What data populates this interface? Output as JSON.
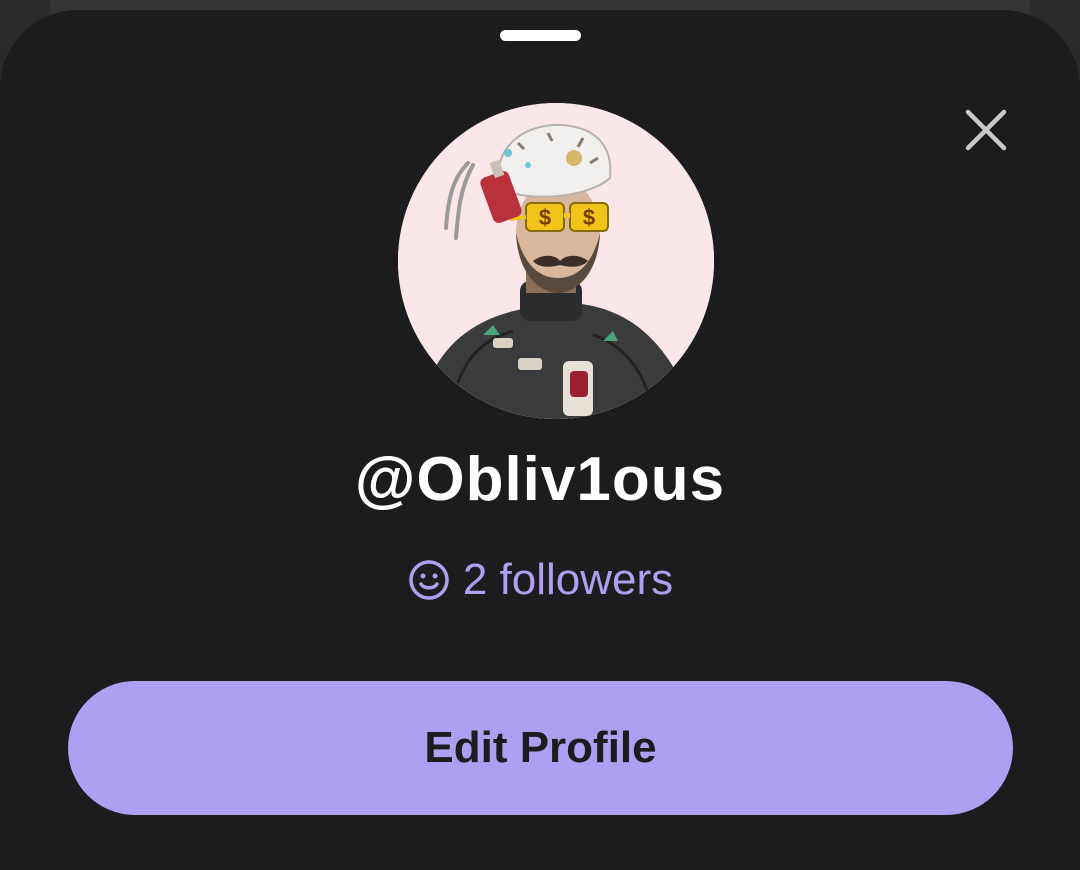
{
  "profile": {
    "username": "@Obliv1ous",
    "followers_text": "2 followers",
    "avatar_icon": "profile-avatar-nft-illustration"
  },
  "actions": {
    "edit_profile_label": "Edit Profile",
    "close_icon": "close-icon",
    "followers_icon": "smiley-face-icon"
  },
  "colors": {
    "sheet_bg": "#1c1b1d",
    "accent": "#ad9ff1",
    "followers_text": "#b09ff0",
    "avatar_bg": "#fbe7ea"
  }
}
